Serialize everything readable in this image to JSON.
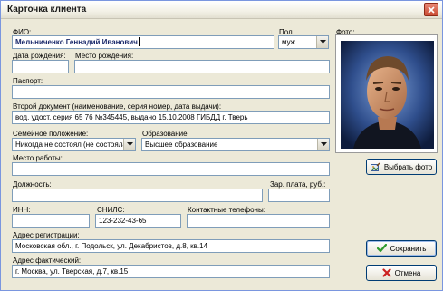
{
  "window": {
    "title": "Карточка клиента"
  },
  "fio": {
    "label": "ФИО:",
    "value": "Мельниченко Геннадий Иванович"
  },
  "gender": {
    "label": "Пол",
    "value": "муж"
  },
  "photo": {
    "label": "Фото:"
  },
  "birth_date": {
    "label": "Дата рождения:",
    "value": ""
  },
  "birth_place": {
    "label": "Место рождения:",
    "value": ""
  },
  "passport": {
    "label": "Паспорт:",
    "value": ""
  },
  "second_doc": {
    "label": "Второй документ (наименование, серия номер, дата выдачи):",
    "value": "вод. удост. серия 65 76 №345445, выдано 15.10.2008 ГИБДД г. Тверь"
  },
  "marital_status": {
    "label": "Семейное положение:",
    "value": "Никогда не состоял (не состояла)"
  },
  "education": {
    "label": "Образование",
    "value": "Высшее образование"
  },
  "workplace": {
    "label": "Место работы:",
    "value": ""
  },
  "position": {
    "label": "Должность:",
    "value": ""
  },
  "salary": {
    "label": "Зар. плата, руб.:",
    "value": ""
  },
  "inn": {
    "label": "ИНН:",
    "value": ""
  },
  "snils": {
    "label": "СНИЛС:",
    "value": "123-232-43-65"
  },
  "phones": {
    "label": "Контактные телефоны:",
    "value": ""
  },
  "reg_address": {
    "label": "Адрес регистрации:",
    "value": "Московская обл., г. Подольск, ул. Декабристов, д.8, кв.14"
  },
  "actual_address": {
    "label": "Адрес фактический:",
    "value": "г. Москва, ул. Тверская, д.7, кв.15"
  },
  "buttons": {
    "choose_photo": "Выбрать фото",
    "save": "Сохранить",
    "cancel": "Отмена"
  },
  "colors": {
    "save_check": "#2e9a2e",
    "cancel_x": "#cc2222",
    "accent_border": "#003c74"
  }
}
